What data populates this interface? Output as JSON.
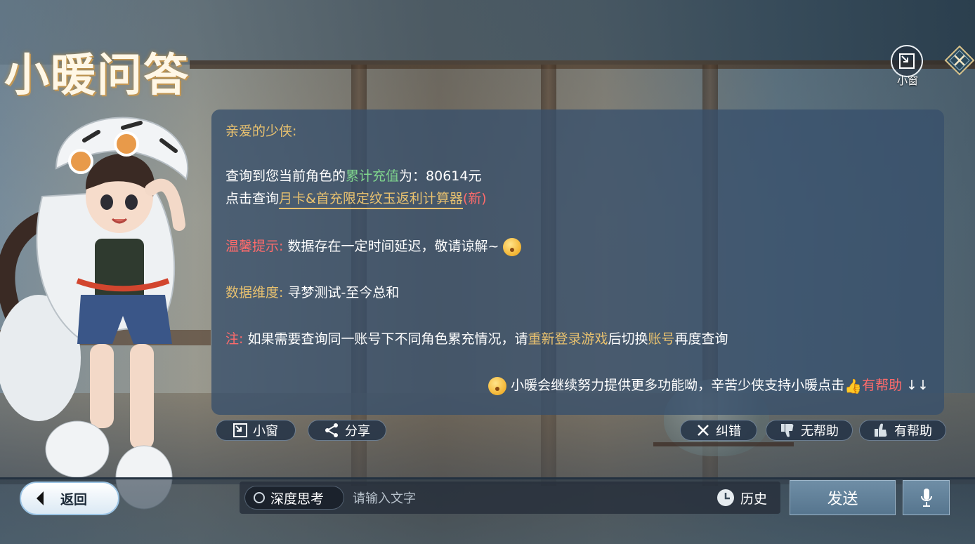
{
  "header": {
    "title": "小暖问答",
    "mini_window_label": "小窗"
  },
  "card": {
    "greeting": "亲爱的少侠:",
    "query_prefix": "查询到您当前角色的",
    "query_term": "累计充值",
    "query_mid": "为：",
    "query_value": "80614元",
    "click_prefix": "点击查询",
    "calc_link": "月卡&首充限定纹玉返利计算器",
    "calc_new": "(新)",
    "tip_label": "温馨提示:",
    "tip_text": "数据存在一定时间延迟，敬请谅解~",
    "dimension_label": "数据维度:",
    "dimension_text": "寻梦测试-至今总和",
    "note_label": "注:",
    "note_text_1": "如果需要查询同一账号下不同角色累充情况，请",
    "note_highlight_1": "重新登录游戏",
    "note_text_2": "后切换",
    "note_highlight_2": "账号",
    "note_text_3": "再度查询",
    "footer_text": "小暖会继续努力提供更多功能呦，辛苦少侠支持小暖点击",
    "footer_helpful": "有帮助",
    "footer_arrows": "↓↓"
  },
  "actions": {
    "mini_window": "小窗",
    "share": "分享",
    "correct": "纠错",
    "not_helpful": "无帮助",
    "helpful": "有帮助"
  },
  "bottom": {
    "back": "返回",
    "deep_think": "深度思考",
    "input_placeholder": "请输入文字",
    "history": "历史",
    "send": "发送"
  },
  "colors": {
    "highlight_gold": "#e8c16f",
    "highlight_green": "#7fd48d",
    "highlight_red": "#ff6b6b",
    "card_bg": "#37506c"
  }
}
